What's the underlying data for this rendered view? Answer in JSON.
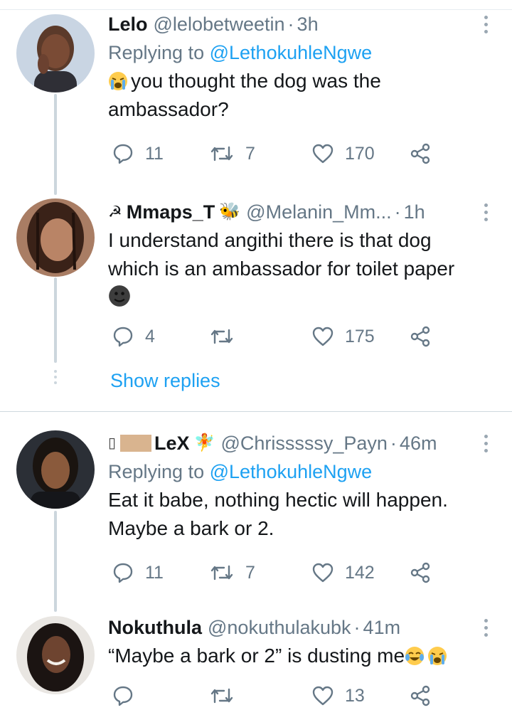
{
  "tweets": [
    {
      "name": "Lelo",
      "handle": "@lelobetweetin",
      "time": "3h",
      "replying_label": "Replying to",
      "replying_to": "@LethokuhleNgwe",
      "text_line1": "you thought the dog was the",
      "text_line2": "ambassador?",
      "replies": "11",
      "retweets": "7",
      "likes": "170"
    },
    {
      "name": "Mmaps_T",
      "handle": "@Melanin_Mm...",
      "time": "1h",
      "text_line1": "I understand angithi there is that dog",
      "text_line2": "which is an ambassador for toilet paper",
      "replies": "4",
      "retweets": "",
      "likes": "175"
    },
    {
      "name": "LeX",
      "handle": "@Chrisssssy_Payn",
      "time": "46m",
      "replying_label": "Replying to",
      "replying_to": "@LethokuhleNgwe",
      "text_line1": "Eat it babe, nothing hectic will happen.",
      "text_line2": "Maybe a bark or 2.",
      "replies": "11",
      "retweets": "7",
      "likes": "142"
    },
    {
      "name": "Nokuthula",
      "handle": "@nokuthulakubk",
      "time": "41m",
      "text_line1": "“Maybe a bark or 2” is dusting me",
      "replies": "",
      "retweets": "",
      "likes": "13"
    }
  ],
  "thread": {
    "show_replies": "Show replies"
  },
  "separator": "·",
  "colors": {
    "accent": "#1da1f2",
    "muted": "#657786",
    "text": "#14171a",
    "line": "#ccd6dd"
  },
  "icons": [
    "reply-icon",
    "retweet-icon",
    "like-icon",
    "share-icon",
    "more-icon",
    "crying-emoji",
    "laughing-emoji",
    "smirk-emoji",
    "bee-emoji",
    "fairy-emoji",
    "hammer-sickle"
  ]
}
